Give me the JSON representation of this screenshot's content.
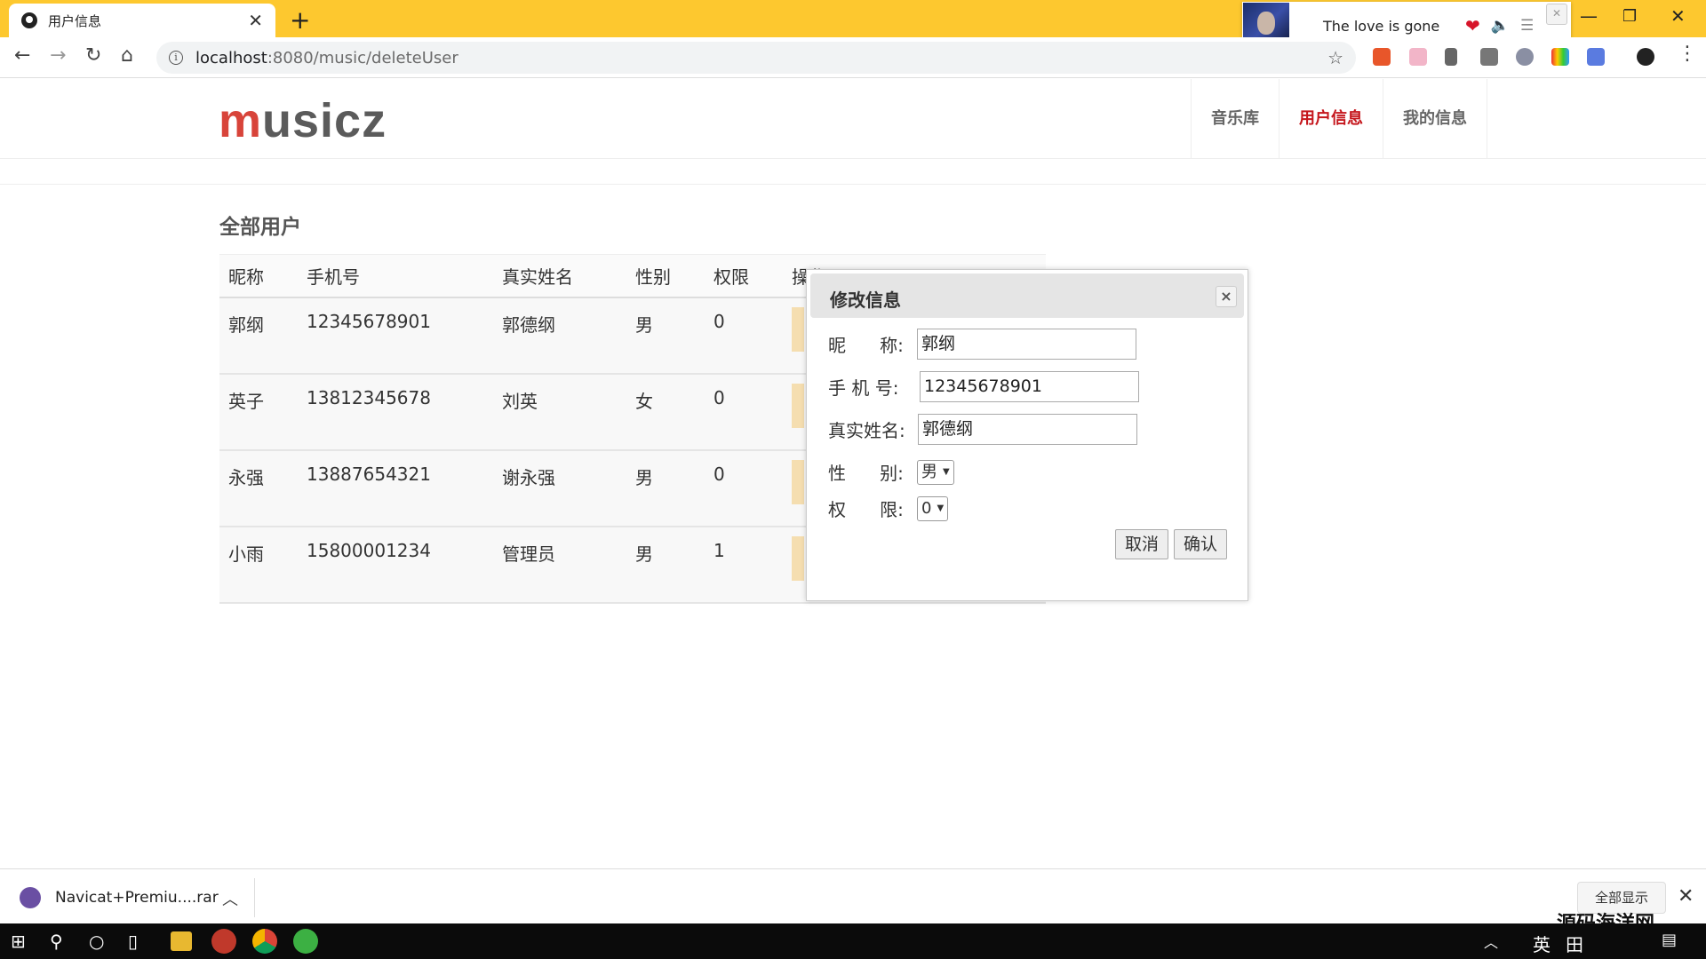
{
  "browser": {
    "tab_title": "用户信息",
    "url_host": "localhost",
    "url_path": ":8080/music/deleteUser"
  },
  "music_widget": {
    "song_title": "The love is gone"
  },
  "site": {
    "logo_m": "m",
    "logo_rest": "usicz",
    "nav": [
      {
        "label": "音乐库",
        "active": false
      },
      {
        "label": "用户信息",
        "active": true
      },
      {
        "label": "我的信息",
        "active": false
      }
    ]
  },
  "page": {
    "section_title": "全部用户",
    "table": {
      "headers": [
        "昵称",
        "手机号",
        "真实姓名",
        "性别",
        "权限",
        "操作"
      ],
      "rows": [
        [
          "郭纲",
          "12345678901",
          "郭德纲",
          "男",
          "0"
        ],
        [
          "英子",
          "13812345678",
          "刘英",
          "女",
          "0"
        ],
        [
          "永强",
          "13887654321",
          "谢永强",
          "男",
          "0"
        ],
        [
          "小雨",
          "15800001234",
          "管理员",
          "男",
          "1"
        ]
      ]
    }
  },
  "modal": {
    "title": "修改信息",
    "close_glyph": "×",
    "labels": {
      "nickname": "昵      称:",
      "phone": "手 机 号:",
      "realname": "真实姓名:",
      "gender": "性      别:",
      "permission": "权      限:"
    },
    "values": {
      "nickname": "郭纲",
      "phone": "12345678901",
      "realname": "郭德纲",
      "gender": "男",
      "permission": "0"
    },
    "cancel_label": "取消",
    "confirm_label": "确认"
  },
  "download_bar": {
    "file_name": "Navicat+Premiu....rar",
    "show_all_label": "全部显示"
  },
  "watermark": "源码海洋网",
  "taskbar": {
    "ime_label": "英",
    "ime2_label": "田"
  },
  "colors": {
    "tabstrip": "#fdc82f",
    "logo_accent": "#d8443a",
    "nav_active": "#c5161c",
    "op_bar": "#f5deb0"
  }
}
